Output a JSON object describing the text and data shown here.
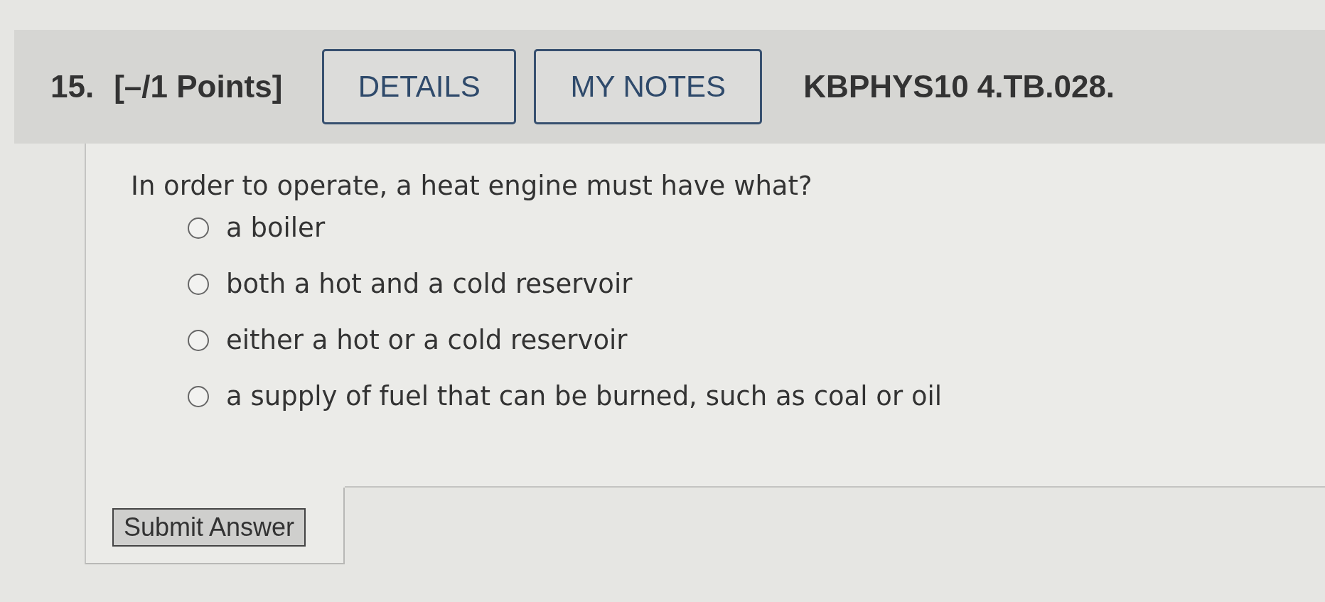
{
  "header": {
    "number": "15.",
    "points": "[–/1 Points]",
    "buttons": [
      {
        "label": "DETAILS"
      },
      {
        "label": "MY NOTES"
      }
    ],
    "code": "KBPHYS10 4.TB.028."
  },
  "prompt": "In order to operate, a heat engine must have what?",
  "options": [
    {
      "label": "a boiler",
      "selected": false
    },
    {
      "label": "both a hot and a cold reservoir",
      "selected": false
    },
    {
      "label": "either a hot or a cold reservoir",
      "selected": false
    },
    {
      "label": "a supply of fuel that can be burned, such as coal or oil",
      "selected": false
    }
  ],
  "submit": {
    "label": "Submit Answer"
  }
}
